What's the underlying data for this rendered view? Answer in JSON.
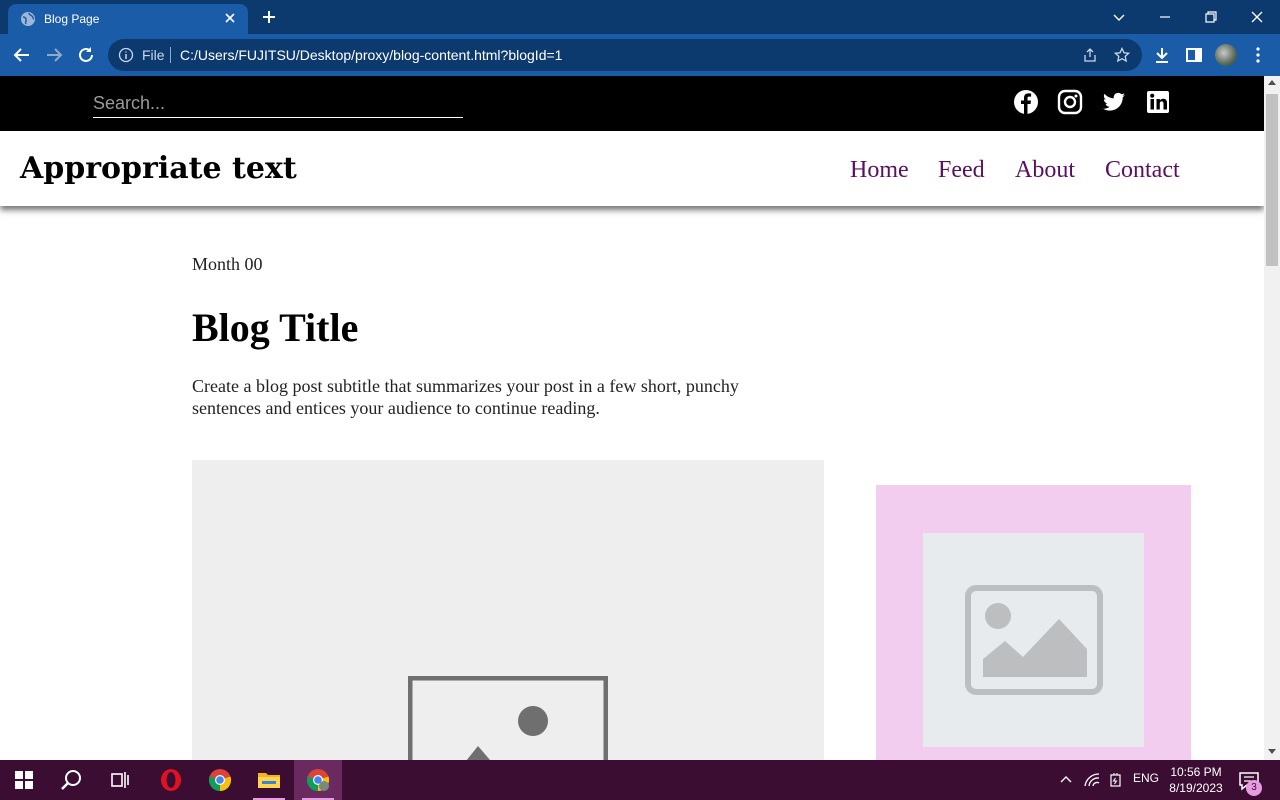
{
  "browser": {
    "tab_title": "Blog Page",
    "url_scheme_label": "File",
    "url": "C:/Users/FUJITSU/Desktop/proxy/blog-content.html?blogId=1"
  },
  "site": {
    "search_placeholder": "Search...",
    "title": "Appropriate text",
    "nav": [
      {
        "label": "Home"
      },
      {
        "label": "Feed"
      },
      {
        "label": "About"
      },
      {
        "label": "Contact"
      }
    ],
    "social_icons": [
      "facebook-icon",
      "instagram-icon",
      "twitter-icon",
      "linkedin-icon"
    ]
  },
  "post": {
    "date": "Month 00",
    "title": "Blog Title",
    "subtitle": "Create a blog post subtitle that summarizes your post in a few short, punchy sentences and entices your audience to continue reading."
  },
  "taskbar": {
    "language": "ENG",
    "time": "10:56 PM",
    "date": "8/19/2023",
    "notification_count": "3"
  },
  "colors": {
    "nav_link": "#5a1060",
    "topbar": "#000000",
    "sidecard": "#f3cdf0",
    "taskbar": "#3b0d33",
    "chrome": "#1a5ca8"
  }
}
